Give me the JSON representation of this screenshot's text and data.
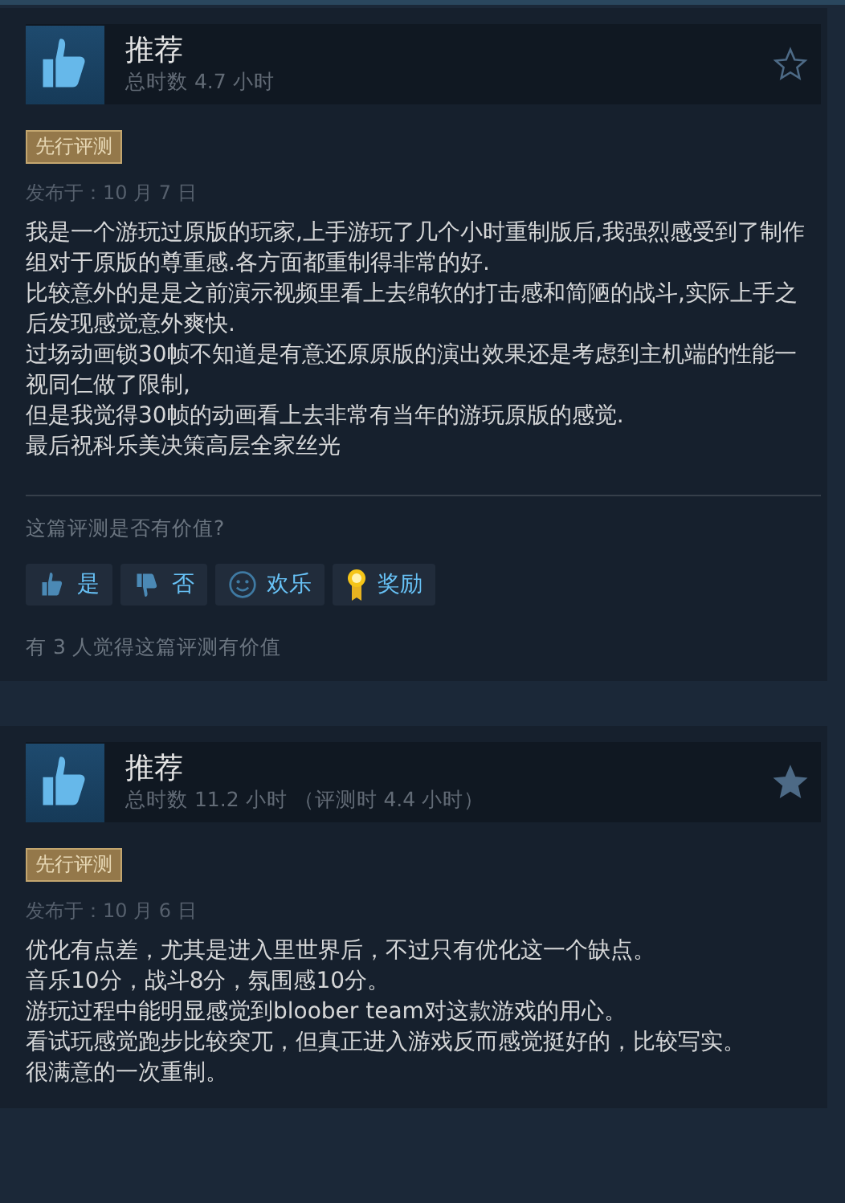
{
  "reviews": [
    {
      "verdict": "推荐",
      "playtime": "总时数 4.7 小时",
      "starred": false,
      "badge": "先行评测",
      "posted": "发布于：10 月 7 日",
      "paragraphs": [
        "我是一个游玩过原版的玩家,上手游玩了几个小时重制版后,我强烈感受到了制作组对于原版的尊重感.各方面都重制得非常的好.",
        "比较意外的是是之前演示视频里看上去绵软的打击感和简陋的战斗,实际上手之后发现感觉意外爽快.",
        "过场动画锁30帧不知道是有意还原原版的演出效果还是考虑到主机端的性能一视同仁做了限制,",
        "但是我觉得30帧的动画看上去非常有当年的游玩原版的感觉.",
        "最后祝科乐美决策高层全家丝光"
      ],
      "helpful_prompt": "这篇评测是否有价值?",
      "votes": [
        {
          "kind": "yes",
          "label": "是"
        },
        {
          "kind": "no",
          "label": "否"
        },
        {
          "kind": "funny",
          "label": "欢乐"
        },
        {
          "kind": "award",
          "label": "奖励"
        }
      ],
      "helpful_count": "有 3 人觉得这篇评测有价值"
    },
    {
      "verdict": "推荐",
      "playtime": "总时数 11.2 小时 （评测时 4.4 小时）",
      "starred": true,
      "badge": "先行评测",
      "posted": "发布于：10 月 6 日",
      "paragraphs": [
        "优化有点差，尤其是进入里世界后，不过只有优化这一个缺点。",
        "音乐10分，战斗8分，氛围感10分。",
        "游玩过程中能明显感觉到bloober team对这款游戏的用心。",
        "看试玩感觉跑步比较突兀，但真正进入游戏反而感觉挺好的，比较写实。",
        "很满意的一次重制。"
      ]
    }
  ]
}
